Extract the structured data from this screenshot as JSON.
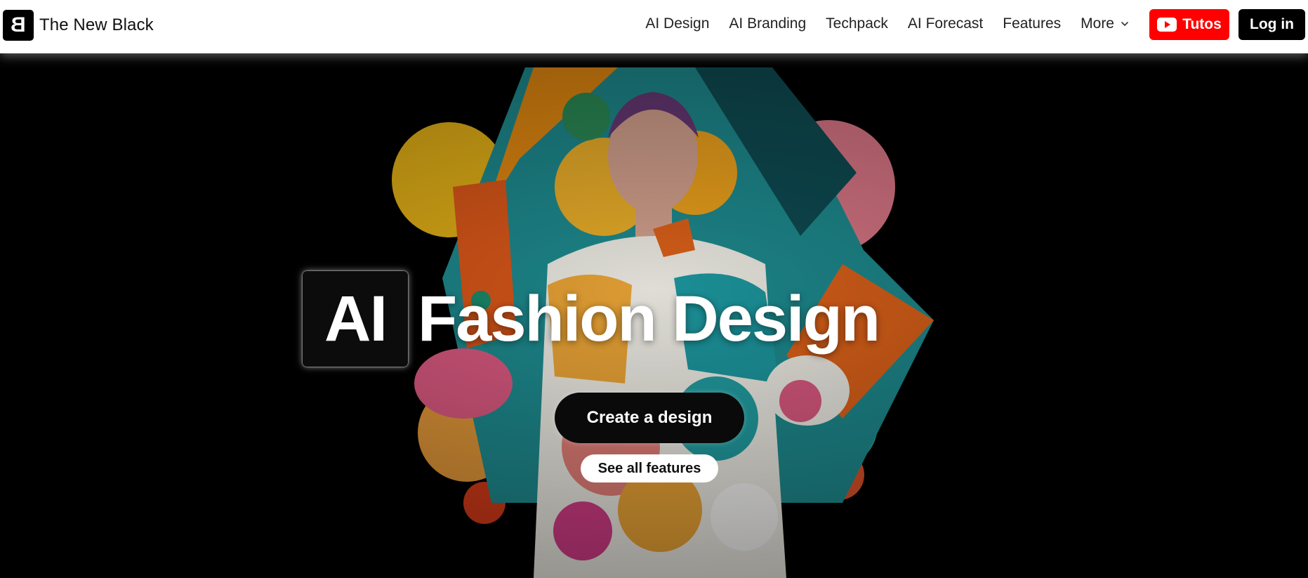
{
  "brand": {
    "logo_letter": "B",
    "name": "The New Black"
  },
  "nav": {
    "items": [
      "AI Design",
      "AI Branding",
      "Techpack",
      "AI Forecast",
      "Features"
    ],
    "more_label": "More"
  },
  "header_buttons": {
    "tutos_label": "Tutos",
    "login_label": "Log in"
  },
  "hero": {
    "title_box": "AI",
    "title_rest": "Fashion Design",
    "primary_cta": "Create a design",
    "secondary_cta": "See all features"
  },
  "colors": {
    "tutos_red": "#ff0000",
    "primary_black": "#000000",
    "header_bg": "#ffffff"
  },
  "icons": [
    "chevron-down-icon",
    "youtube-icon"
  ]
}
